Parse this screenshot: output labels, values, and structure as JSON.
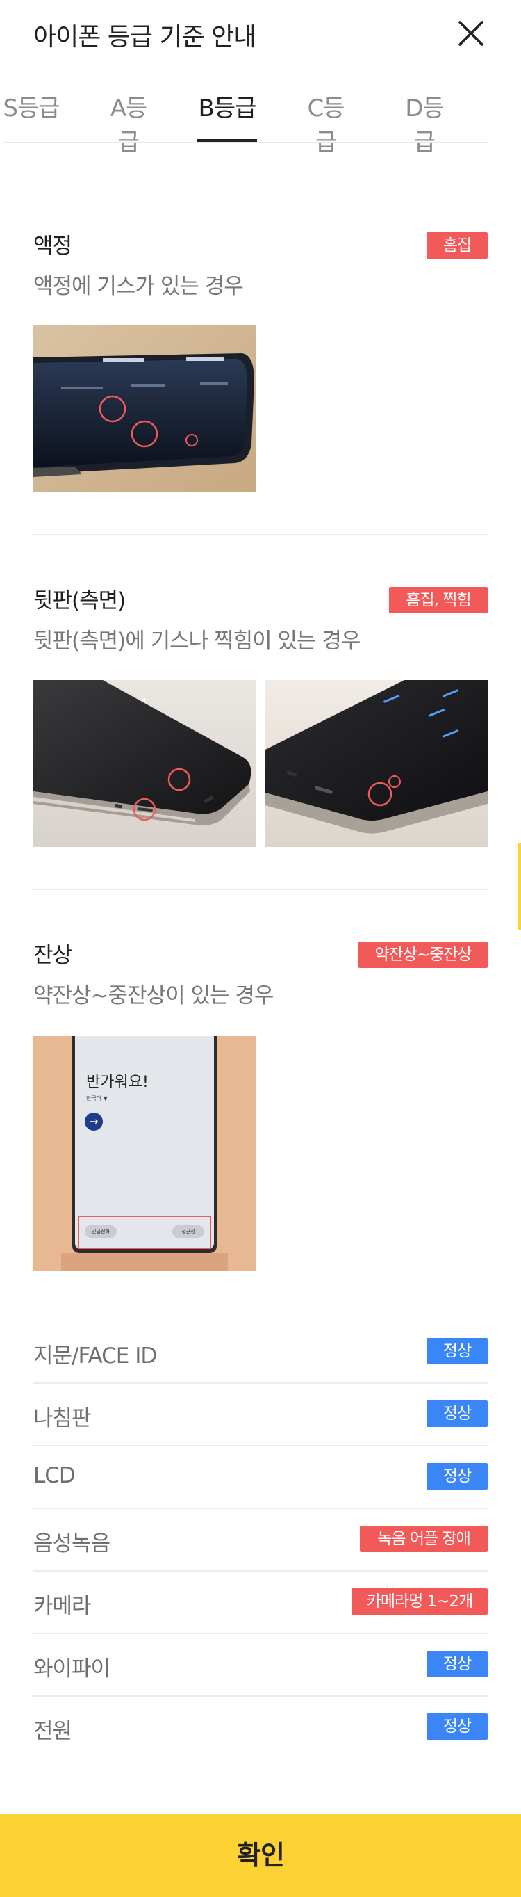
{
  "header": {
    "title": "아이폰 등급 기준 안내",
    "close_icon": "close-icon"
  },
  "tabs": [
    {
      "label": "S등급"
    },
    {
      "label": "A등급"
    },
    {
      "label": "B등급",
      "active": true
    },
    {
      "label": "C등급"
    },
    {
      "label": "D등급"
    }
  ],
  "sections": [
    {
      "title": "액정",
      "badge": "흠집",
      "badge_color": "#f25a5a",
      "desc": "액정에 기스가 있는 경우"
    },
    {
      "title": "뒷판(측면)",
      "badge": "흠집, 찍힘",
      "badge_color": "#f25a5a",
      "desc": "뒷판(측면)에 기스나 찍힘이 있는 경우"
    },
    {
      "title": "잔상",
      "badge": "약잔상~중잔상",
      "badge_color": "#f25a5a",
      "desc": "약잔상~중잔상이 있는 경우",
      "photo_text": {
        "greeting": "반가워요!",
        "language": "한국어 ▼",
        "left_button": "긴급전화",
        "right_button": "접근성"
      }
    }
  ],
  "status_rows": [
    {
      "label": "지문/FACE ID",
      "badge": "정상",
      "color": "blue"
    },
    {
      "label": "나침판",
      "badge": "정상",
      "color": "blue"
    },
    {
      "label": "LCD",
      "badge": "정상",
      "color": "blue"
    },
    {
      "label": "음성녹음",
      "badge": "녹음 어플 장애",
      "color": "red"
    },
    {
      "label": "카메라",
      "badge": "카메라멍 1~2개",
      "color": "red"
    },
    {
      "label": "와이파이",
      "badge": "정상",
      "color": "blue"
    },
    {
      "label": "전원",
      "badge": "정상",
      "color": "blue"
    }
  ],
  "confirm_label": "확인",
  "colors": {
    "accent": "#fdd235",
    "badge_red": "#f25a5a",
    "badge_blue": "#3b86f7"
  }
}
